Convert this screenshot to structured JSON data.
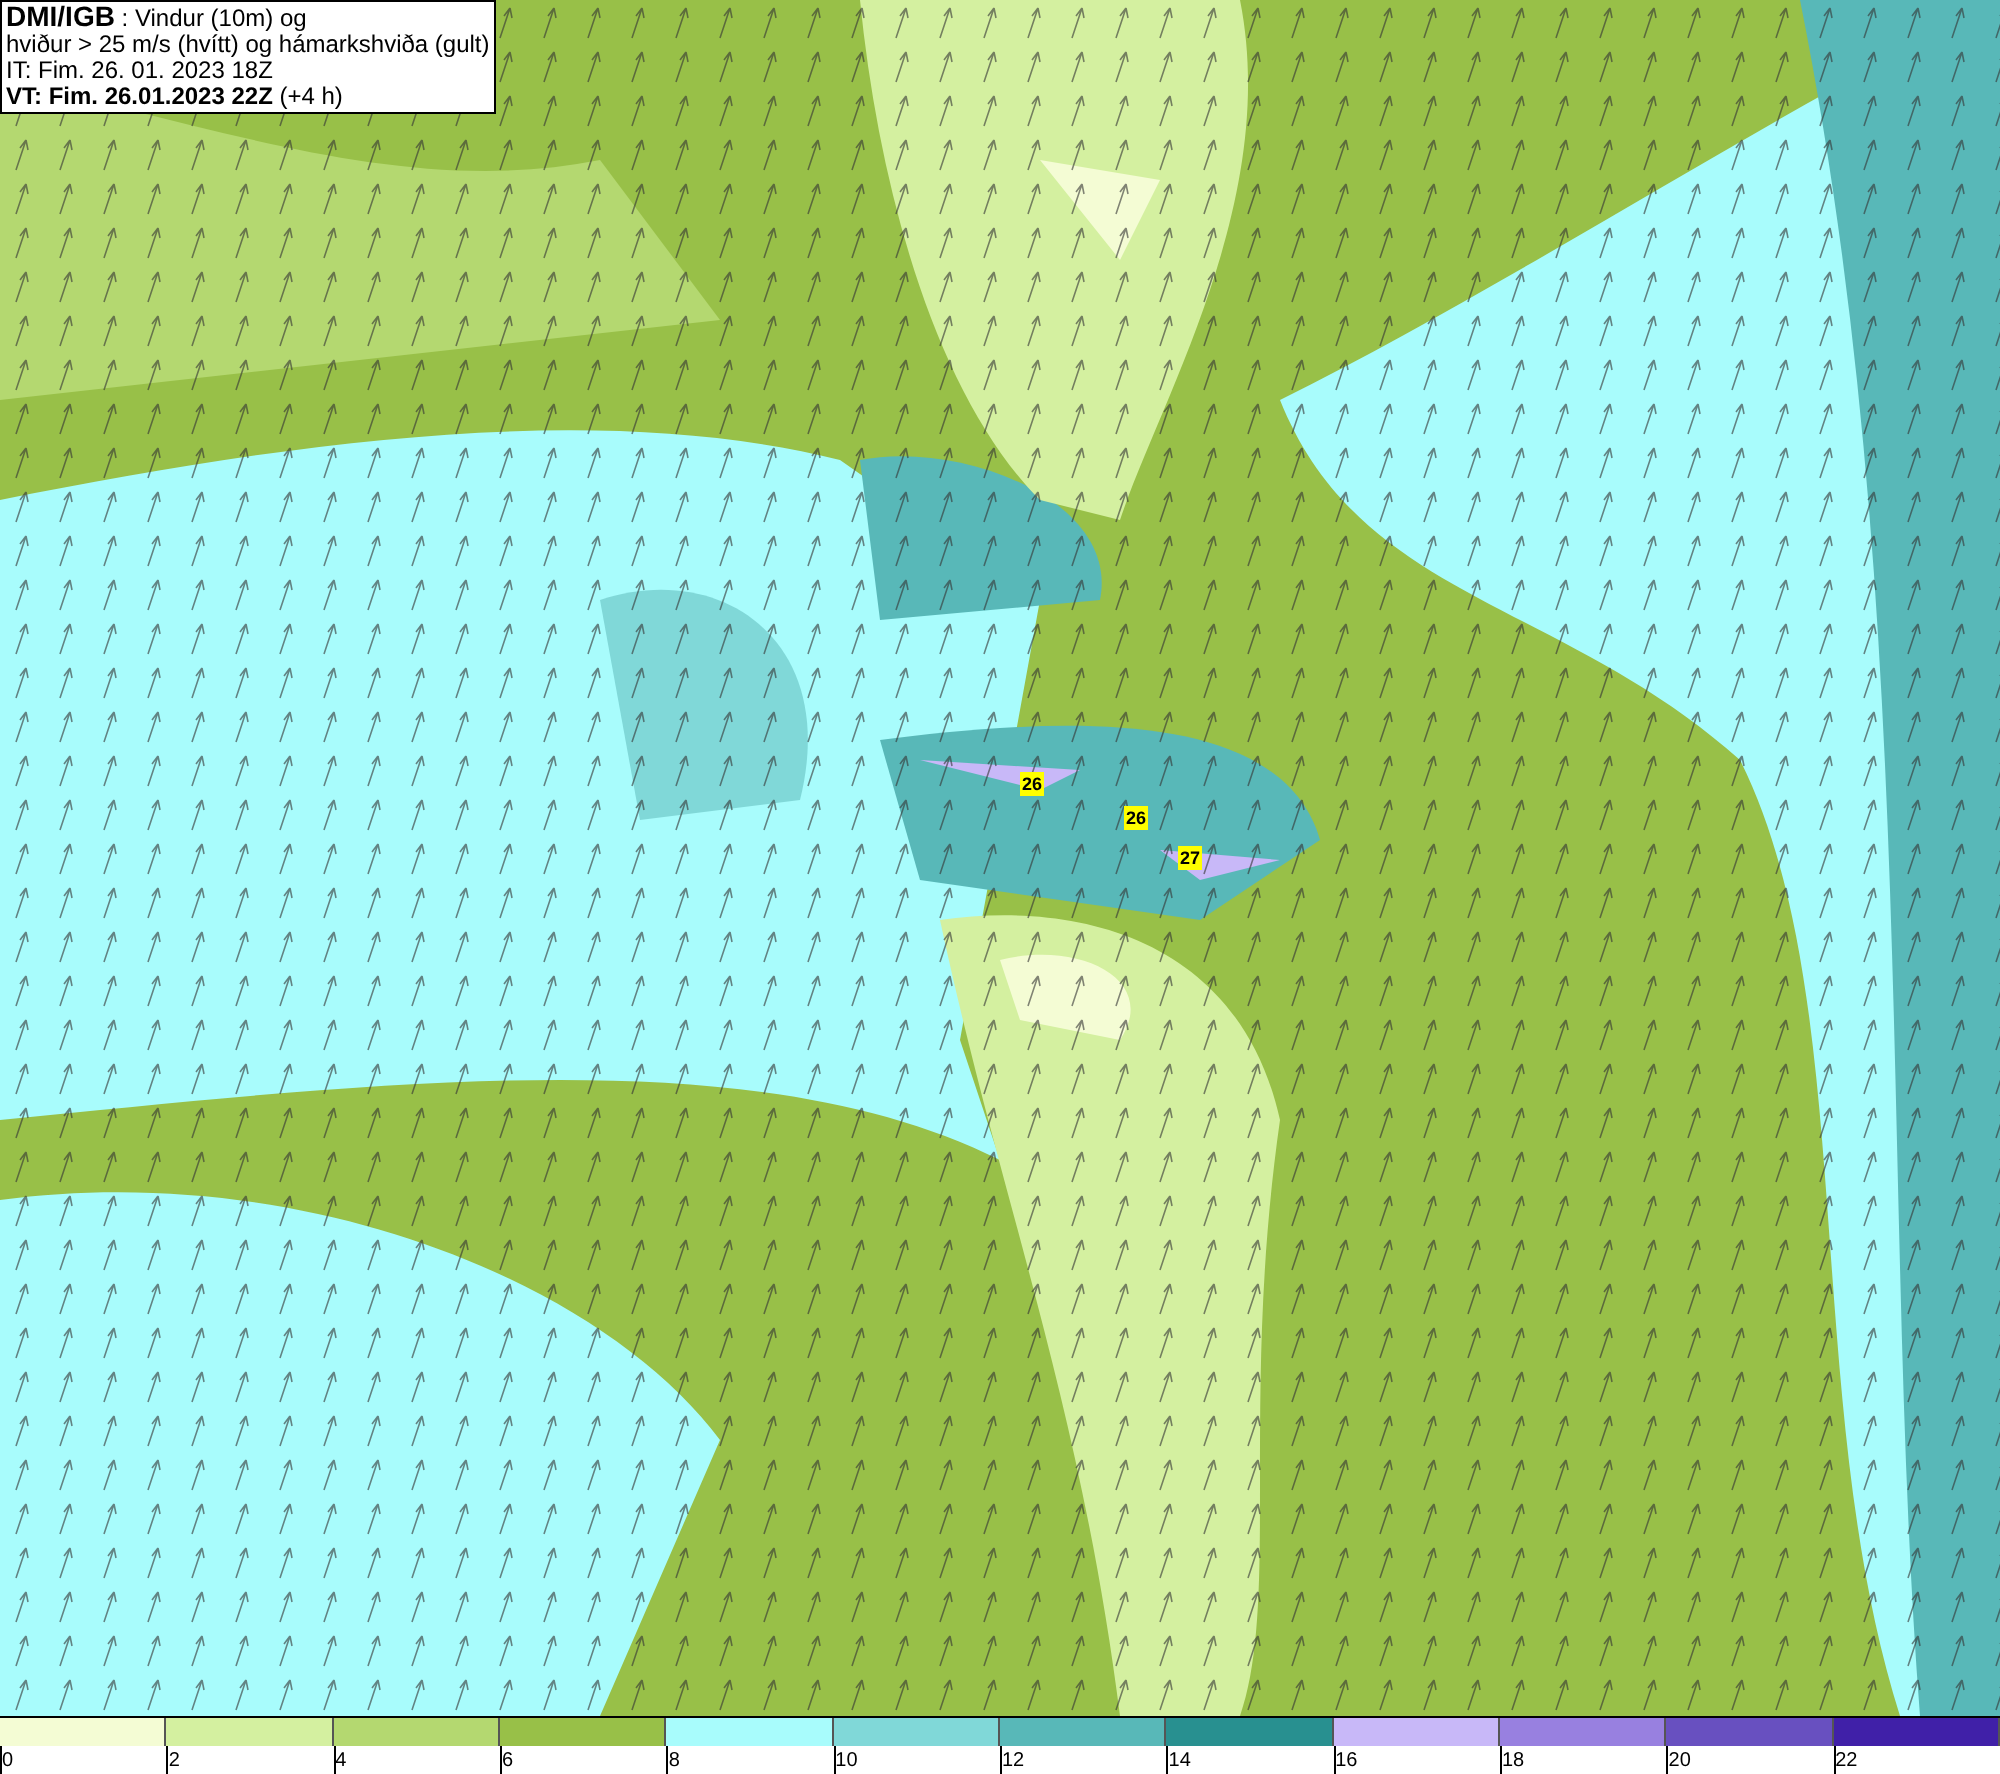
{
  "header": {
    "source": "DMI/IGB",
    "title": ": Vindur (10m) og",
    "subtitle": "hviður > 25 m/s (hvítt) og hámarkshviða (gult)",
    "initial_time": "IT: Fim. 26. 01. 2023 18Z",
    "valid_time": "VT: Fim. 26.01.2023 22Z",
    "lead": "(+4 h)"
  },
  "gust_labels": [
    "26",
    "26",
    "27"
  ],
  "legend": [
    {
      "label": "0",
      "color": "#f4fcd4"
    },
    {
      "label": "2",
      "color": "#d4f0a0"
    },
    {
      "label": "4",
      "color": "#b4d870"
    },
    {
      "label": "6",
      "color": "#98c048"
    },
    {
      "label": "8",
      "color": "#a8fcfc"
    },
    {
      "label": "10",
      "color": "#80d8d8"
    },
    {
      "label": "12",
      "color": "#58b8b8"
    },
    {
      "label": "14",
      "color": "#289090"
    },
    {
      "label": "16",
      "color": "#c8b8f8"
    },
    {
      "label": "18",
      "color": "#9880e0"
    },
    {
      "label": "20",
      "color": "#6850c0"
    },
    {
      "label": "22",
      "color": "#4020a8"
    }
  ]
}
